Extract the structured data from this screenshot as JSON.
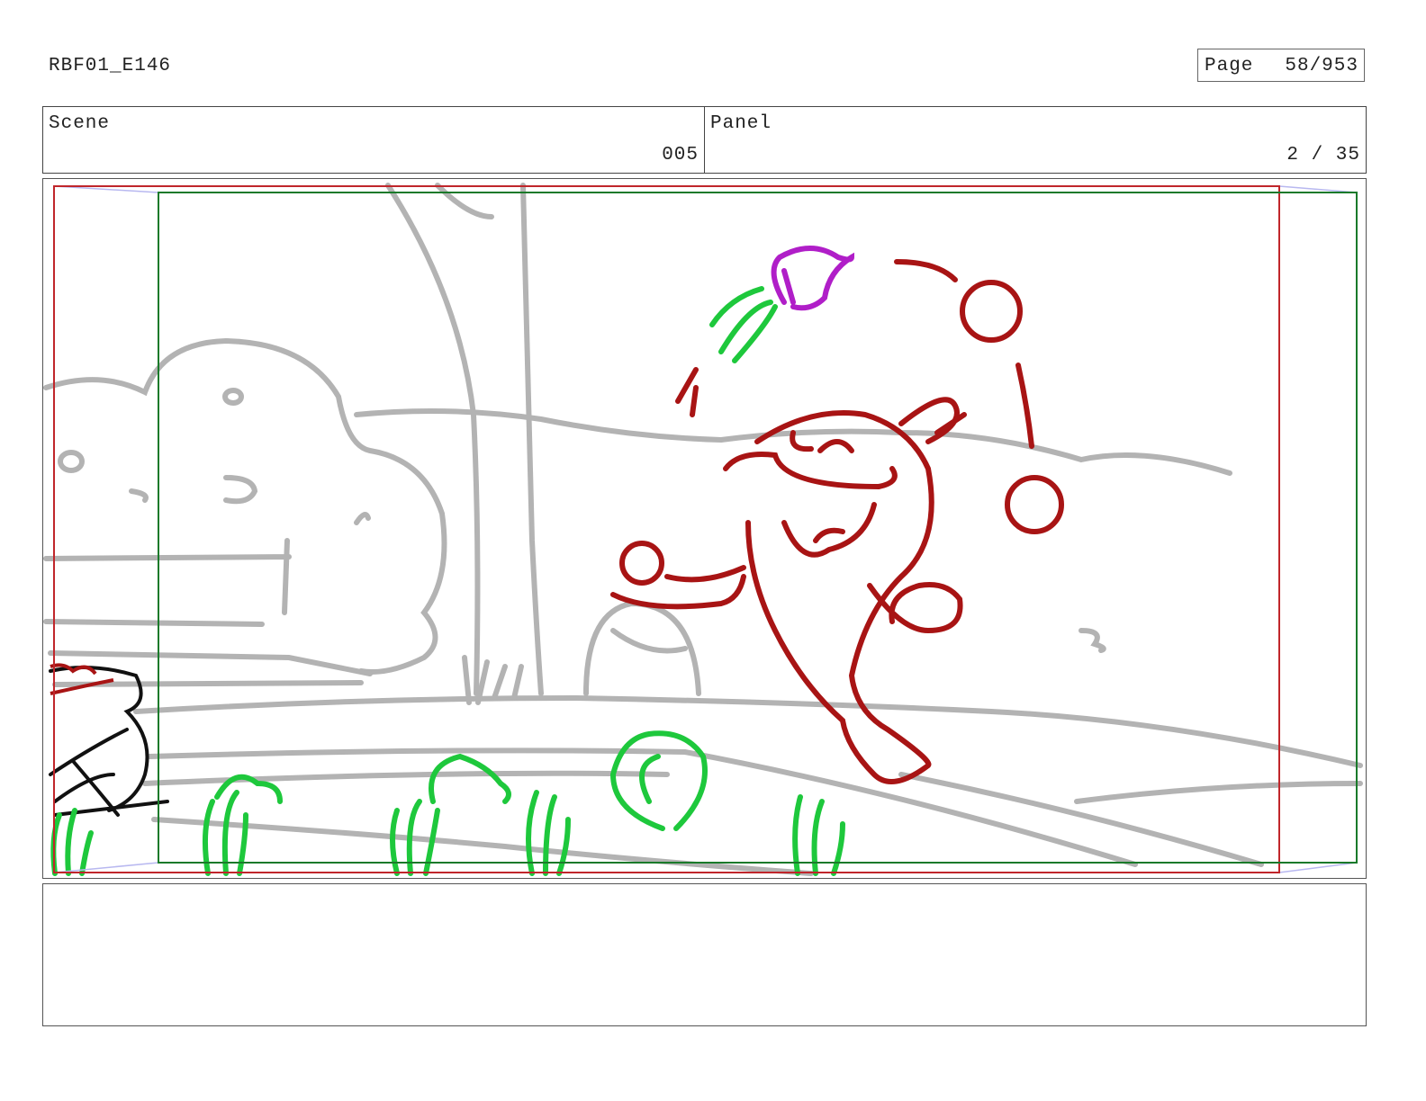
{
  "header": {
    "production_code": "RBF01_E146",
    "page_label": "Page",
    "page_value": "58/953"
  },
  "info": {
    "scene_label": "Scene",
    "scene_value": "005",
    "panel_label": "Panel",
    "panel_value": "2 / 35"
  },
  "colors": {
    "safe_frame": "#c0262b",
    "camera_frame": "#1a7a2a",
    "background_sketch": "#b3b3b3",
    "character_sketch": "#a81414",
    "foliage_sketch": "#1ec83c",
    "accent_sketch": "#b01ec8"
  },
  "notes": {
    "text": ""
  }
}
